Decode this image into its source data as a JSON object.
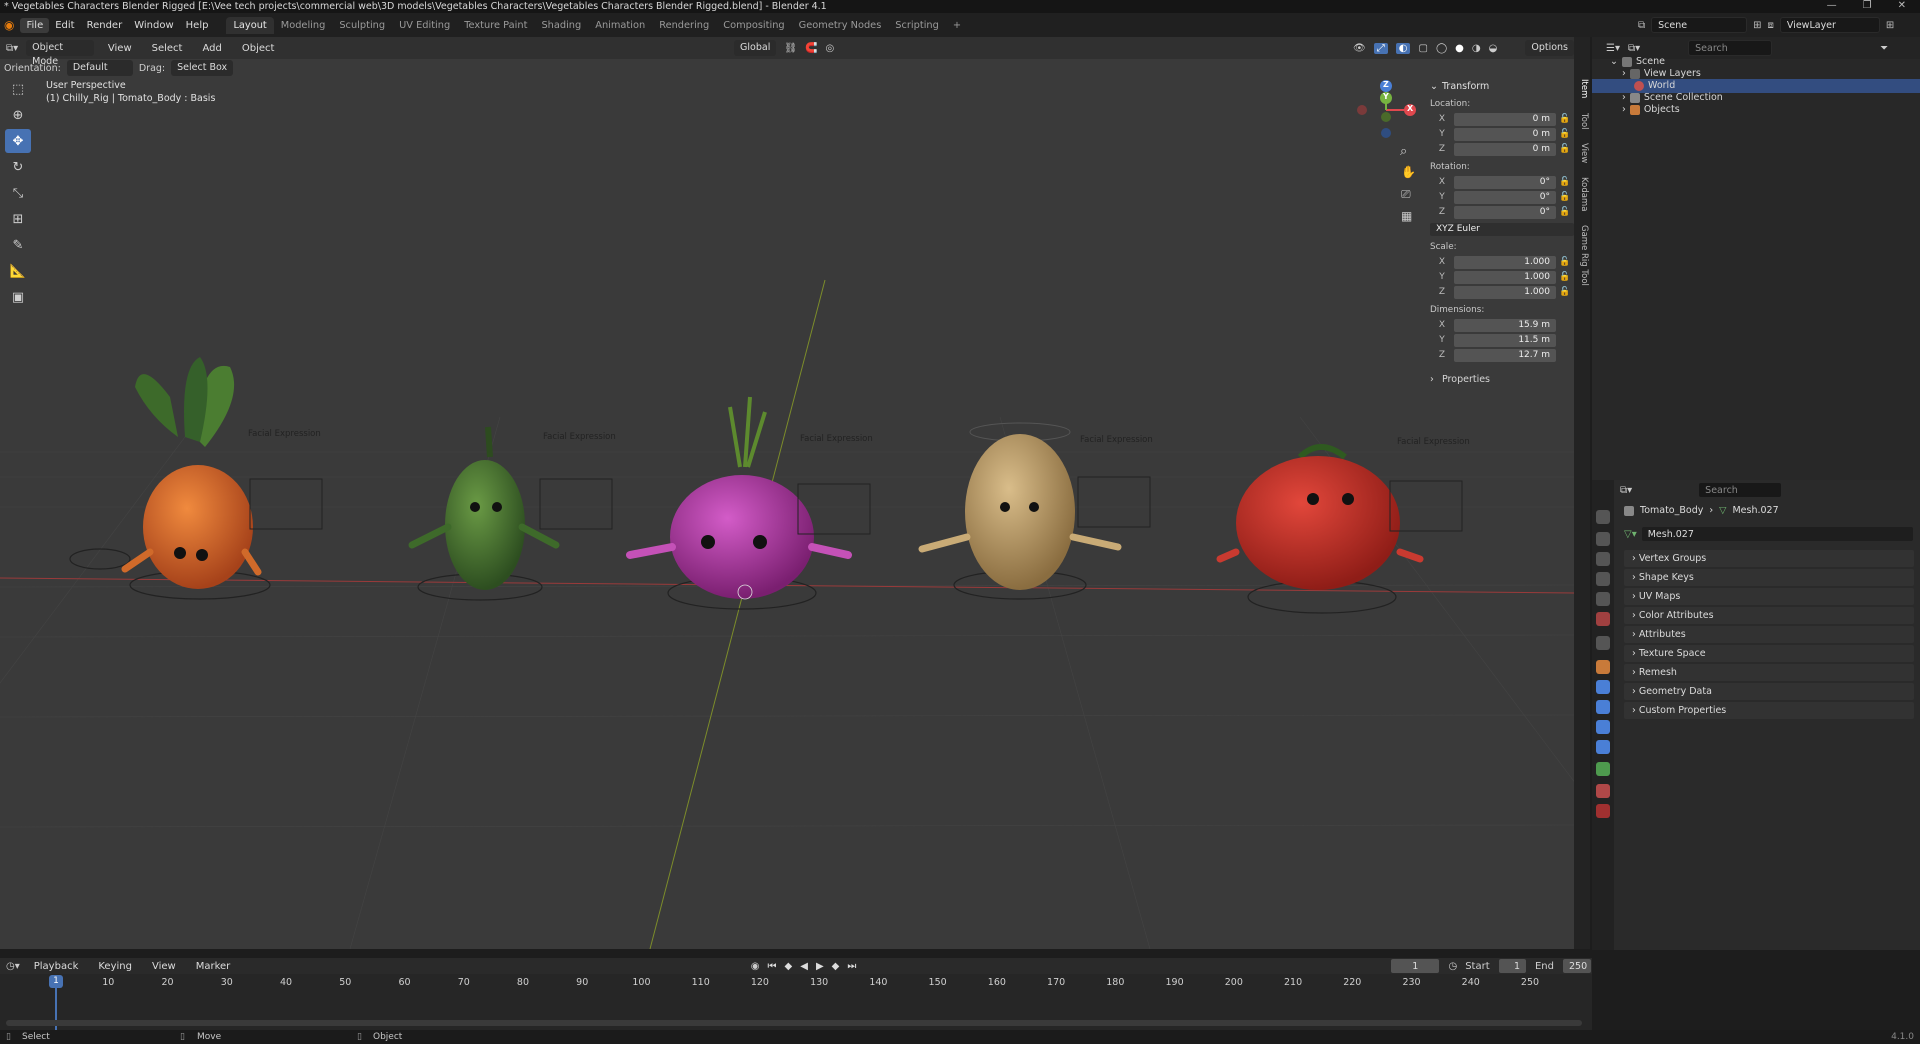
{
  "window": {
    "title": "* Vegetables Characters Blender Rigged [E:\\Vee tech projects\\commercial web\\3D models\\Vegetables Characters\\Vegetables Characters Blender Rigged.blend] - Blender 4.1",
    "controls": [
      "—",
      "❐",
      "✕"
    ]
  },
  "menu": [
    "File",
    "Edit",
    "Render",
    "Window",
    "Help"
  ],
  "workspaces": [
    "Layout",
    "Modeling",
    "Sculpting",
    "UV Editing",
    "Texture Paint",
    "Shading",
    "Animation",
    "Rendering",
    "Compositing",
    "Geometry Nodes",
    "Scripting",
    "+"
  ],
  "top_right": {
    "scene": "Scene",
    "view_layer": "ViewLayer"
  },
  "viewport": {
    "mode": "Object Mode",
    "menus": [
      "View",
      "Select",
      "Add",
      "Object"
    ],
    "transform_orientation": "Global",
    "options_label": "Options",
    "orientation_label": "Orientation:",
    "orientation_value": "Default",
    "drag_label": "Drag:",
    "drag_value": "Select Box",
    "info_line1": "User Perspective",
    "info_line2": "(1) Chilly_Rig | Tomato_Body : Basis",
    "board_label": "Facial Expression",
    "gizmo_axes": [
      "X",
      "Y",
      "Z"
    ]
  },
  "npanel": {
    "header": "Transform",
    "location_label": "Location:",
    "location": [
      "0 m",
      "0 m",
      "0 m"
    ],
    "rotation_label": "Rotation:",
    "rotation": [
      "0°",
      "0°",
      "0°"
    ],
    "rotation_mode": "XYZ Euler",
    "scale_label": "Scale:",
    "scale": [
      "1.000",
      "1.000",
      "1.000"
    ],
    "dimensions_label": "Dimensions:",
    "dimensions": [
      "15.9 m",
      "11.5 m",
      "12.7 m"
    ],
    "properties_label": "Properties",
    "tabs": [
      "Item",
      "Tool",
      "View",
      "Kodama",
      "Game Rig Tool"
    ]
  },
  "outliner": {
    "search_placeholder": "Search",
    "items": [
      "Scene",
      "View Layers",
      "World",
      "Scene Collection",
      "Objects"
    ]
  },
  "properties": {
    "search_placeholder": "Search",
    "breadcrumb_object": "Tomato_Body",
    "breadcrumb_mesh": "Mesh.027",
    "mesh_name": "Mesh.027",
    "sections": [
      "Vertex Groups",
      "Shape Keys",
      "UV Maps",
      "Color Attributes",
      "Attributes",
      "Texture Space",
      "Remesh",
      "Geometry Data",
      "Custom Properties"
    ]
  },
  "timeline": {
    "menus": [
      "Playback",
      "Keying",
      "View",
      "Marker"
    ],
    "current_frame": "1",
    "start_label": "Start",
    "start": "1",
    "end_label": "End",
    "end": "250",
    "ticks": [
      "1",
      "10",
      "20",
      "30",
      "40",
      "50",
      "60",
      "70",
      "80",
      "90",
      "100",
      "110",
      "120",
      "130",
      "140",
      "150",
      "160",
      "170",
      "180",
      "190",
      "200",
      "210",
      "220",
      "230",
      "240",
      "250"
    ]
  },
  "status": {
    "select": "Select",
    "move": "Move",
    "object": "Object",
    "version": "4.1.0"
  },
  "colors": {
    "accent": "#4772b3",
    "x_axis": "#e0484e",
    "y_axis": "#76b340",
    "z_axis": "#4a7fd6",
    "selected_row": "#334d80"
  }
}
